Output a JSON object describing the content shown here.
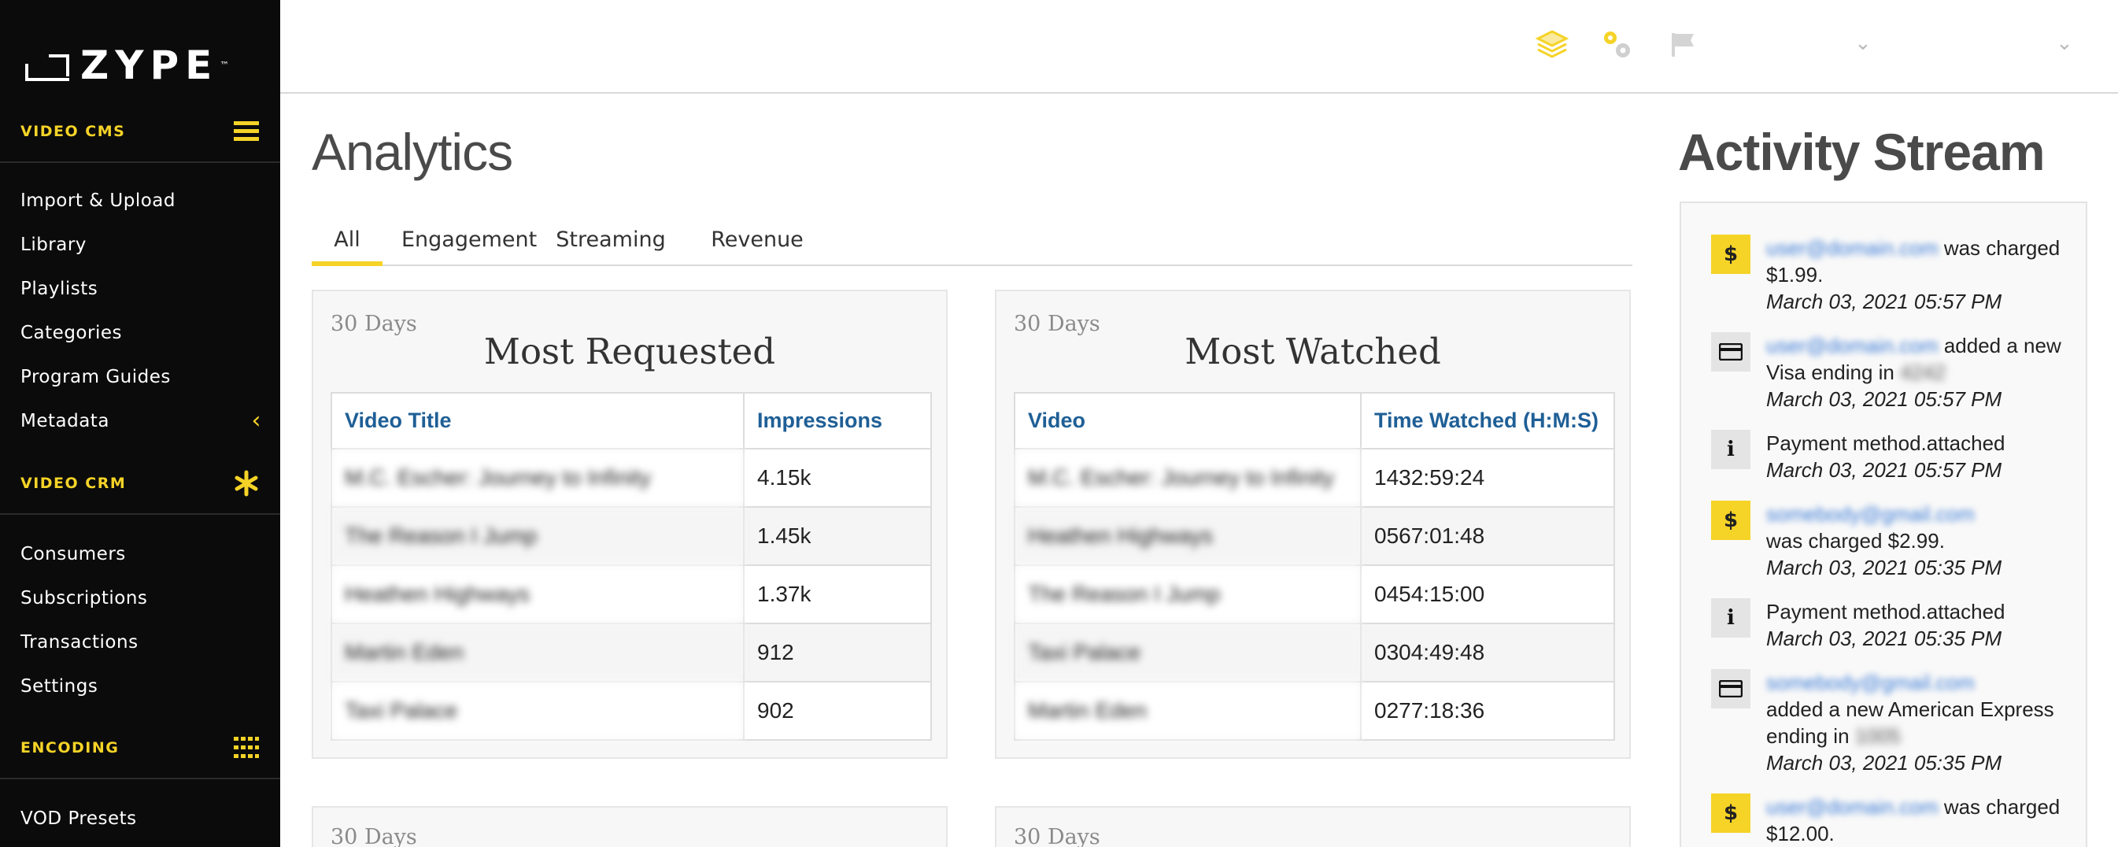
{
  "brand": {
    "logo_text": "ZYPE",
    "trademark": "™"
  },
  "sidebar": {
    "sections": [
      {
        "title": "VIDEO CMS",
        "icon": "hamburger-menu-icon",
        "items": [
          "Import & Upload",
          "Library",
          "Playlists",
          "Categories",
          "Program Guides",
          "Metadata"
        ]
      },
      {
        "title": "VIDEO CRM",
        "icon": "asterisk-icon",
        "items": [
          "Consumers",
          "Subscriptions",
          "Transactions",
          "Settings"
        ]
      },
      {
        "title": "ENCODING",
        "icon": "grid-icon",
        "items": [
          "VOD Presets"
        ]
      }
    ]
  },
  "topbar": {
    "icons": [
      "stack-layers-icon",
      "gears-icon",
      "flag-icon"
    ]
  },
  "main": {
    "title": "Analytics",
    "tabs": [
      {
        "label": "All",
        "active": true
      },
      {
        "label": "Engagement",
        "active": false
      },
      {
        "label": "Streaming",
        "active": false
      },
      {
        "label": "Revenue",
        "active": false
      }
    ],
    "cards": [
      {
        "range": "30 Days",
        "title": "Most Requested",
        "columns": [
          "Video Title",
          "Impressions"
        ],
        "rows": [
          [
            "M.C. Escher: Journey to Infinity",
            "4.15k"
          ],
          [
            "The Reason I Jump",
            "1.45k"
          ],
          [
            "Heathen Highways",
            "1.37k"
          ],
          [
            "Martin Eden",
            "912"
          ],
          [
            "Taxi Palace",
            "902"
          ]
        ]
      },
      {
        "range": "30 Days",
        "title": "Most Watched",
        "columns": [
          "Video",
          "Time Watched (H:M:S)"
        ],
        "rows": [
          [
            "M.C. Escher: Journey to Infinity",
            "1432:59:24"
          ],
          [
            "Heathen Highways",
            "0567:01:48"
          ],
          [
            "The Reason I Jump",
            "0454:15:00"
          ],
          [
            "Taxi Palace",
            "0304:49:48"
          ],
          [
            "Martin Eden",
            "0277:18:36"
          ]
        ]
      }
    ],
    "bottom_cards": [
      {
        "range": "30 Days"
      },
      {
        "range": "30 Days"
      }
    ]
  },
  "activity": {
    "title": "Activity Stream",
    "items": [
      {
        "icon": "dollar-icon",
        "user": "user@domain.com",
        "text": " was charged $1.99.",
        "date": "March 03, 2021 05:57 PM"
      },
      {
        "icon": "credit-card-icon",
        "user": "user@domain.com",
        "text": " added a new Visa ending in ",
        "suffix": "4242",
        "date": "March 03, 2021 05:57 PM"
      },
      {
        "icon": "info-icon",
        "user": "",
        "text": "Payment method.attached",
        "date": "March 03, 2021 05:57 PM"
      },
      {
        "icon": "dollar-icon",
        "user": "somebody@gmail.com",
        "text": "was charged $2.99.",
        "date": "March 03, 2021 05:35 PM"
      },
      {
        "icon": "info-icon",
        "user": "",
        "text": "Payment method.attached",
        "date": "March 03, 2021 05:35 PM"
      },
      {
        "icon": "credit-card-icon",
        "user": "somebody@gmail.com",
        "text": "added a new American Express ending in ",
        "suffix": "1005",
        "date": "March 03, 2021 05:35 PM"
      },
      {
        "icon": "dollar-icon",
        "user": "user@domain.com",
        "text": " was charged $12.00.",
        "date": ""
      }
    ]
  },
  "colors": {
    "accent": "#f5d327",
    "sidebar_bg": "#0b0b0b",
    "table_header": "#1f5f96"
  }
}
